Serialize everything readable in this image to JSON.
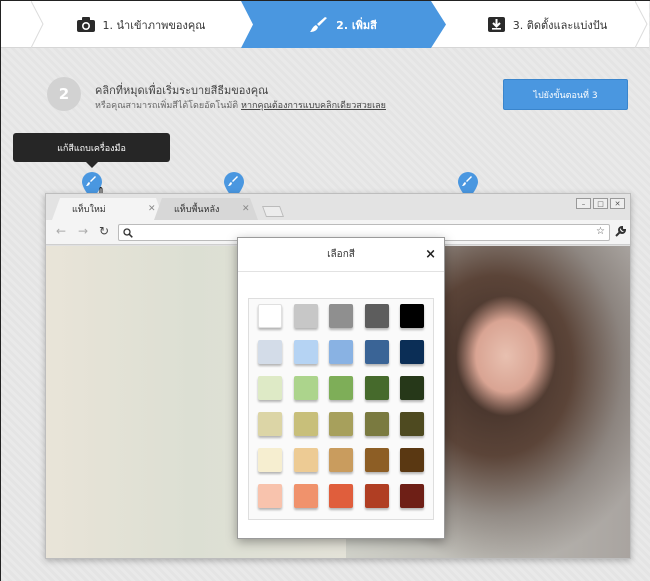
{
  "steps": [
    {
      "label": "1. นำเข้าภาพของคุณ",
      "icon": "camera-icon"
    },
    {
      "label": "2. เพิ่มสี",
      "icon": "paintbrush-icon",
      "active": true
    },
    {
      "label": "3. ติดตั้งและแบ่งปัน",
      "icon": "download-icon"
    }
  ],
  "intro": {
    "number": "2",
    "title": "คลิกที่หมุดเพื่อเริ่มระบายสีธีมของคุณ",
    "subtitle": "หรือคุณสามารถเพิ่มสีได้โดยอัตโนมัติ",
    "subtitle_link": "หากคุณต้องการแบบคลิกเดียวสวยเลย"
  },
  "next_button": "ไปยังขั้นตอนที่ 3",
  "tooltip": "แก้สีแถบเครื่องมือ",
  "browser": {
    "tabs": [
      {
        "label": "แท็บใหม่"
      },
      {
        "label": "แท็บพื้นหลัง"
      }
    ]
  },
  "picker": {
    "title": "เลือกสี",
    "close": "×",
    "swatches": [
      [
        "#ffffff",
        "#c7c7c7",
        "#8f8f8f",
        "#5d5d5d",
        "#000000"
      ],
      [
        "#d3dce8",
        "#b5d3f3",
        "#89b2e3",
        "#3a6496",
        "#0b2e56"
      ],
      [
        "#deeac6",
        "#acd48c",
        "#7eae58",
        "#466a2c",
        "#263819"
      ],
      [
        "#dcd5a6",
        "#c8bf7a",
        "#a7a05c",
        "#7a7a40",
        "#4e4a20"
      ],
      [
        "#f6eed0",
        "#edcb94",
        "#c99c5e",
        "#8d5e25",
        "#5a3812"
      ],
      [
        "#f8c3ad",
        "#f0926c",
        "#e05e3c",
        "#b03e23",
        "#6e1f16"
      ]
    ]
  }
}
